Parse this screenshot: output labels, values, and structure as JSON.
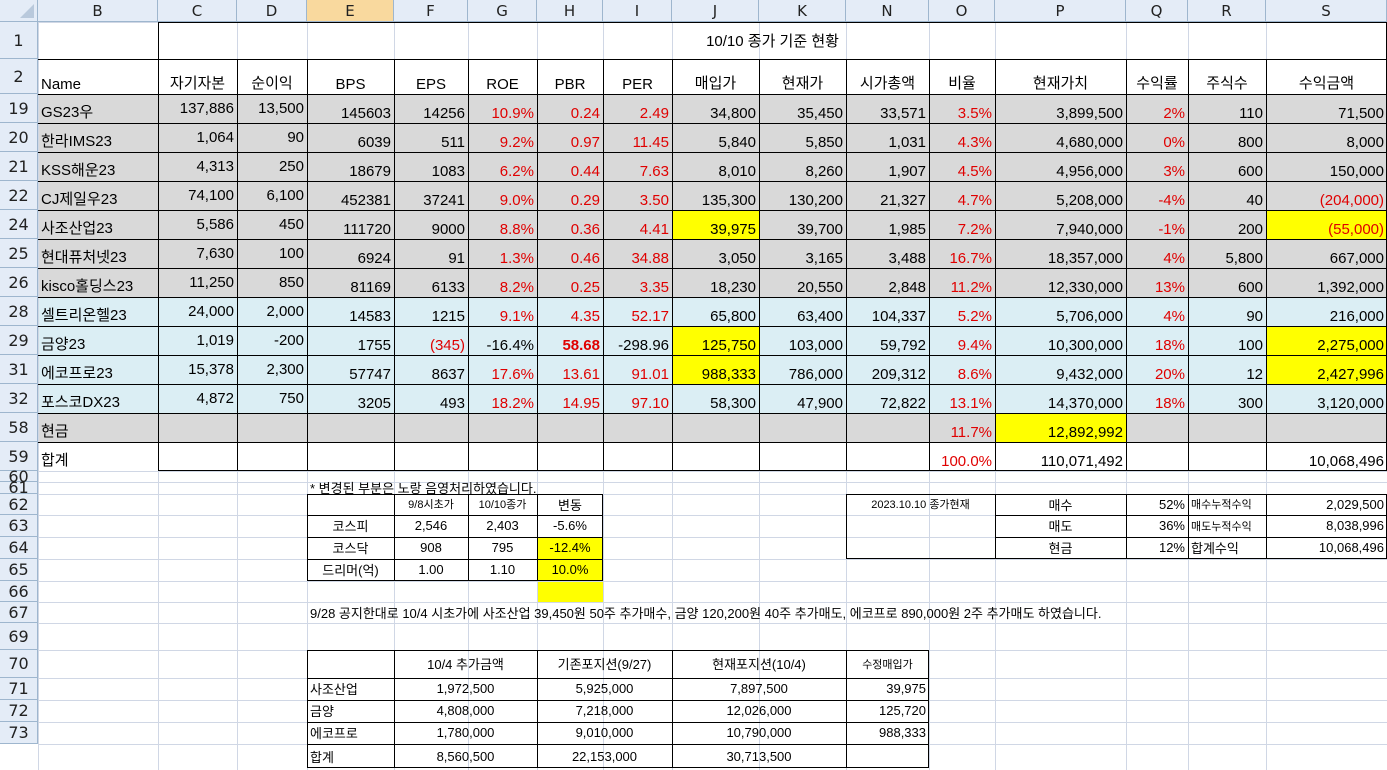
{
  "sheet": {
    "columns": [
      "B",
      "C",
      "D",
      "E",
      "F",
      "G",
      "H",
      "I",
      "J",
      "K",
      "N",
      "O",
      "P",
      "Q",
      "R",
      "S"
    ],
    "selected_column": "E",
    "row_numbers": [
      "1",
      "2",
      "19",
      "20",
      "21",
      "22",
      "24",
      "25",
      "26",
      "28",
      "29",
      "31",
      "32",
      "58",
      "59",
      "60",
      "61",
      "62",
      "63",
      "64",
      "65",
      "66",
      "67",
      "69",
      "70",
      "71",
      "72",
      "73"
    ]
  },
  "title": "10/10 종가 기준 현황",
  "headers": [
    "Name",
    "자기자본",
    "순이익",
    "BPS",
    "EPS",
    "ROE",
    "PBR",
    "PER",
    "매입가",
    "현재가",
    "시가총액",
    "비율",
    "현재가치",
    "수익률",
    "주식수",
    "수익금액"
  ],
  "holdings": [
    {
      "name": "GS23우",
      "equity": "137,886",
      "net": "13,500",
      "bps": "145603",
      "eps": "14256",
      "roe": "10.9%",
      "pbr": "0.24",
      "per": "2.49",
      "buy": "34,800",
      "price": "35,450",
      "mcap": "33,571",
      "ratio": "3.5%",
      "value": "3,899,500",
      "ret": "2%",
      "shares": "110",
      "profit": "71,500"
    },
    {
      "name": "한라IMS23",
      "equity": "1,064",
      "net": "90",
      "bps": "6039",
      "eps": "511",
      "roe": "9.2%",
      "pbr": "0.97",
      "per": "11.45",
      "buy": "5,840",
      "price": "5,850",
      "mcap": "1,031",
      "ratio": "4.3%",
      "value": "4,680,000",
      "ret": "0%",
      "shares": "800",
      "profit": "8,000"
    },
    {
      "name": "KSS해운23",
      "equity": "4,313",
      "net": "250",
      "bps": "18679",
      "eps": "1083",
      "roe": "6.2%",
      "pbr": "0.44",
      "per": "7.63",
      "buy": "8,010",
      "price": "8,260",
      "mcap": "1,907",
      "ratio": "4.5%",
      "value": "4,956,000",
      "ret": "3%",
      "shares": "600",
      "profit": "150,000"
    },
    {
      "name": "CJ제일우23",
      "equity": "74,100",
      "net": "6,100",
      "bps": "452381",
      "eps": "37241",
      "roe": "9.0%",
      "pbr": "0.29",
      "per": "3.50",
      "buy": "135,300",
      "price": "130,200",
      "mcap": "21,327",
      "ratio": "4.7%",
      "value": "5,208,000",
      "ret": "-4%",
      "shares": "40",
      "profit": "(204,000)"
    },
    {
      "name": "사조산업23",
      "equity": "5,586",
      "net": "450",
      "bps": "111720",
      "eps": "9000",
      "roe": "8.8%",
      "pbr": "0.36",
      "per": "4.41",
      "buy": "39,975",
      "price": "39,700",
      "mcap": "1,985",
      "ratio": "7.2%",
      "value": "7,940,000",
      "ret": "-1%",
      "shares": "200",
      "profit": "(55,000)"
    },
    {
      "name": "현대퓨처넷23",
      "equity": "7,630",
      "net": "100",
      "bps": "6924",
      "eps": "91",
      "roe": "1.3%",
      "pbr": "0.46",
      "per": "34.88",
      "buy": "3,050",
      "price": "3,165",
      "mcap": "3,488",
      "ratio": "16.7%",
      "value": "18,357,000",
      "ret": "4%",
      "shares": "5,800",
      "profit": "667,000"
    },
    {
      "name": "kisco홀딩스23",
      "equity": "11,250",
      "net": "850",
      "bps": "81169",
      "eps": "6133",
      "roe": "8.2%",
      "pbr": "0.25",
      "per": "3.35",
      "buy": "18,230",
      "price": "20,550",
      "mcap": "2,848",
      "ratio": "11.2%",
      "value": "12,330,000",
      "ret": "13%",
      "shares": "600",
      "profit": "1,392,000"
    },
    {
      "name": "셀트리온헬23",
      "equity": "24,000",
      "net": "2,000",
      "bps": "14583",
      "eps": "1215",
      "roe": "9.1%",
      "pbr": "4.35",
      "per": "52.17",
      "buy": "65,800",
      "price": "63,400",
      "mcap": "104,337",
      "ratio": "5.2%",
      "value": "5,706,000",
      "ret": "4%",
      "shares": "90",
      "profit": "216,000"
    },
    {
      "name": "금양23",
      "equity": "1,019",
      "net": "-200",
      "bps": "1755",
      "eps": "(345)",
      "roe": "-16.4%",
      "pbr": "58.68",
      "per": "-298.96",
      "buy": "125,750",
      "price": "103,000",
      "mcap": "59,792",
      "ratio": "9.4%",
      "value": "10,300,000",
      "ret": "18%",
      "shares": "100",
      "profit": "2,275,000"
    },
    {
      "name": "에코프로23",
      "equity": "15,378",
      "net": "2,300",
      "bps": "57747",
      "eps": "8637",
      "roe": "17.6%",
      "pbr": "13.61",
      "per": "91.01",
      "buy": "988,333",
      "price": "786,000",
      "mcap": "209,312",
      "ratio": "8.6%",
      "value": "9,432,000",
      "ret": "20%",
      "shares": "12",
      "profit": "2,427,996"
    },
    {
      "name": "포스코DX23",
      "equity": "4,872",
      "net": "750",
      "bps": "3205",
      "eps": "493",
      "roe": "18.2%",
      "pbr": "14.95",
      "per": "97.10",
      "buy": "58,300",
      "price": "47,900",
      "mcap": "72,822",
      "ratio": "13.1%",
      "value": "14,370,000",
      "ret": "18%",
      "shares": "300",
      "profit": "3,120,000"
    }
  ],
  "cash": {
    "name": "현금",
    "ratio": "11.7%",
    "value": "12,892,992"
  },
  "total": {
    "name": "합계",
    "ratio": "100.0%",
    "value": "110,071,492",
    "profit": "10,068,496"
  },
  "note": "* 변경된 부분은 노랑 음영처리하였습니다.",
  "index_table": {
    "headers": [
      "9/8시초가",
      "10/10종가",
      "변동"
    ],
    "rows": [
      {
        "name": "코스피",
        "a": "2,546",
        "b": "2,403",
        "c": "-5.6%"
      },
      {
        "name": "코스닥",
        "a": "908",
        "b": "795",
        "c": "-12.4%"
      },
      {
        "name": "드리머(억)",
        "a": "1.00",
        "b": "1.10",
        "c": "10.0%"
      }
    ]
  },
  "summary": {
    "date_label": "2023.10.10 종가현재",
    "rows": [
      {
        "label": "매수",
        "pct": "52%",
        "sub": "매수누적수익",
        "amt": "2,029,500"
      },
      {
        "label": "매도",
        "pct": "36%",
        "sub": "매도누적수익",
        "amt": "8,038,996"
      },
      {
        "label": "현금",
        "pct": "12%",
        "sub": "합계수익",
        "amt": "10,068,496"
      }
    ]
  },
  "announcement": "9/28 공지한대로 10/4 시초가에 사조산업 39,450원 50주 추가매수, 금양 120,200원 40주 추가매도, 에코프로 890,000원 2주 추가매도 하였습니다.",
  "trade_table": {
    "headers": [
      "10/4 추가금액",
      "기존포지션(9/27)",
      "현재포지션(10/4)",
      "수정매입가"
    ],
    "rows": [
      {
        "name": "사조산업",
        "a": "1,972,500",
        "b": "5,925,000",
        "c": "7,897,500",
        "d": "39,975"
      },
      {
        "name": "금양",
        "a": "4,808,000",
        "b": "7,218,000",
        "c": "12,026,000",
        "d": "125,720"
      },
      {
        "name": "에코프로",
        "a": "1,780,000",
        "b": "9,010,000",
        "c": "10,790,000",
        "d": "988,333"
      },
      {
        "name": "합계",
        "a": "8,560,500",
        "b": "22,153,000",
        "c": "30,713,500",
        "d": ""
      }
    ]
  },
  "colors": {
    "gray_row": "#d9d9d9",
    "blue_row": "#dbeef4",
    "highlight": "#ffff00",
    "header_bg": "#e4ecf7",
    "selected_header": "#f9d99e",
    "negative": "#e00000"
  }
}
